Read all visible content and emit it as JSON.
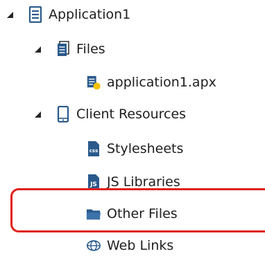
{
  "tree": {
    "root": {
      "label": "Application1",
      "icon": "application-icon",
      "expanded": true
    },
    "files": {
      "label": "Files",
      "icon": "files-folder-icon",
      "expanded": true
    },
    "apx_file": {
      "label": "application1.apx",
      "icon": "apx-file-icon"
    },
    "client_resources": {
      "label": "Client Resources",
      "icon": "client-resources-icon",
      "expanded": true
    },
    "stylesheets": {
      "label": "Stylesheets",
      "icon": "css-icon",
      "icon_text": "css"
    },
    "js_libraries": {
      "label": "JS Libraries",
      "icon": "js-icon",
      "icon_text": "JS"
    },
    "other_files": {
      "label": "Other Files",
      "icon": "folder-icon"
    },
    "web_links": {
      "label": "Web Links",
      "icon": "web-links-icon"
    }
  },
  "colors": {
    "icon_blue": "#2a5a8c",
    "icon_dark": "#2b2b2b",
    "highlight": "#e0201b",
    "badge_yellow": "#f2c200"
  }
}
